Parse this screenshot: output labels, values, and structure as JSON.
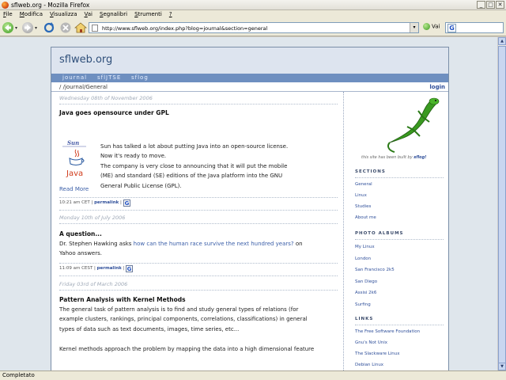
{
  "window": {
    "title": "sflweb.org - Mozilla Firefox",
    "minimize": "_",
    "maximize": "□",
    "close": "✕"
  },
  "menu": {
    "items": [
      {
        "key": "F",
        "rest": "ile"
      },
      {
        "key": "M",
        "rest": "odifica"
      },
      {
        "key": "V",
        "rest": "isualizza"
      },
      {
        "key": "V",
        "rest": "ai"
      },
      {
        "key": "S",
        "rest": "egnalibri"
      },
      {
        "key": "S",
        "rest": "trumenti"
      },
      {
        "key": "?",
        "rest": ""
      }
    ]
  },
  "nav": {
    "url": "http://www.sflweb.org/index.php?blog=journal&section=general",
    "go_label": "Vai",
    "search_icon": "G"
  },
  "site": {
    "title": "sflweb.org",
    "tabs": [
      "journal",
      "sflJTSE",
      "sflog"
    ],
    "breadcrumb": "/ /journal/General",
    "login": "login"
  },
  "posts": [
    {
      "date": "Wednesday 08th of November 2006",
      "title": "Java goes opensource under GPL",
      "logo_sun": "Sun",
      "logo_java": "Java",
      "text": [
        "Sun has talked a lot about putting Java into an open-source license.",
        "Now it's ready to move.",
        "The company is very close to announcing that it will put the mobile",
        "(ME) and standard (SE) editions of the Java platform into the GNU",
        "General Public License (GPL)."
      ],
      "readmore": "Read More",
      "time": "10:21 am CET",
      "permalink": "permalink",
      "gicon": "G"
    },
    {
      "date": "Monday 10th of July 2006",
      "title": "A question...",
      "line1_pre": "Dr. Stephen Hawking asks ",
      "line1_link": "how can the human race survive the next hundred years?",
      "line1_post": " on",
      "line2": "Yahoo answers.",
      "time": "11:09 am CEST",
      "permalink": "permalink",
      "gicon": "G"
    },
    {
      "date": "Friday 03rd of March 2006",
      "title": "Pattern Analysis with Kernel Methods",
      "text": [
        "The general task of pattern analysis is to find and study general types of relations (for",
        "example clusters, rankings, principal components, correlations, classifications) in general",
        "types of data such as text documents, images, time series, etc..."
      ],
      "text2": "Kernel methods approach the problem by mapping the data into a high dimensional feature"
    }
  ],
  "sidebar": {
    "builtby_pre": "this site has been built by",
    "builtby_name": "sflog!",
    "sections_head": "SECTIONS",
    "sections": [
      "General",
      "Linux",
      "Studies",
      "About me"
    ],
    "albums_head": "PHOTO ALBUMS",
    "albums": [
      "My Linux",
      "London",
      "San Francisco 2k5",
      "San Diego",
      "Assisi 2k6",
      "Surfing"
    ],
    "links_head": "LINKS",
    "links": [
      "The Free Software Foundation",
      "Gnu's Not Unix",
      "The Slackware Linux",
      "Debian Linux"
    ]
  },
  "status": {
    "text": "Completato"
  },
  "colors": {
    "accent": "#6e8fc0",
    "link": "#3a5ea8",
    "title": "#2f4f7a"
  }
}
